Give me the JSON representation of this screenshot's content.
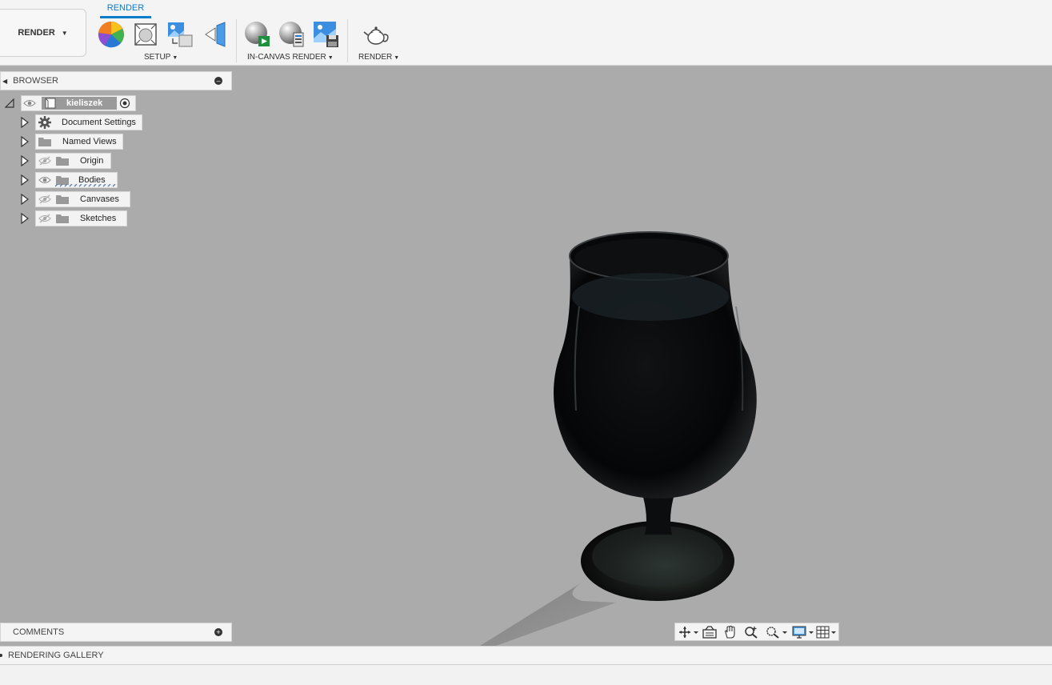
{
  "toolbar": {
    "workspace_label": "RENDER",
    "active_tab": "RENDER",
    "groups": {
      "setup": "SETUP",
      "in_canvas_render": "IN-CANVAS RENDER",
      "render": "RENDER"
    }
  },
  "browser": {
    "title": "BROWSER",
    "root": "kieliszek",
    "items": [
      {
        "label": "Document Settings",
        "icon": "gear-icon"
      },
      {
        "label": "Named Views",
        "icon": "folder-icon"
      },
      {
        "label": "Origin",
        "icon": "folder-icon"
      },
      {
        "label": "Bodies",
        "icon": "folder-icon"
      },
      {
        "label": "Canvases",
        "icon": "folder-icon"
      },
      {
        "label": "Sketches",
        "icon": "folder-icon"
      }
    ]
  },
  "comments": {
    "title": "COMMENTS"
  },
  "gallery": {
    "title": "RENDERING GALLERY"
  },
  "colors": {
    "accent": "#0a7ccc",
    "viewport": "#ababab",
    "panel": "#f4f4f4"
  }
}
